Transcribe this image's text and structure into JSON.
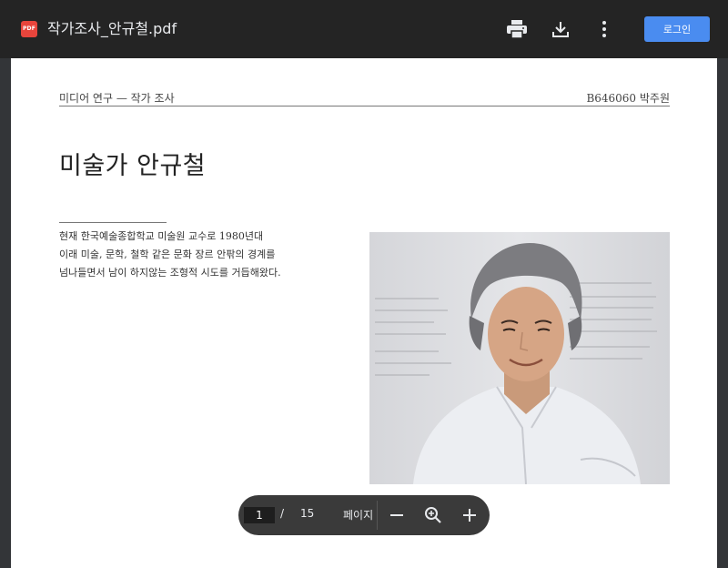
{
  "toolbar": {
    "pdf_badge": "PDF",
    "file_name": "작가조사_안규철.pdf",
    "print_icon": "print-icon",
    "download_icon": "download-icon",
    "more_icon": "more-vert-icon",
    "login_label": "로그인"
  },
  "document": {
    "header_left": "미디어 연구 — 작가 조사",
    "header_right": "B646060 박주원",
    "title": "미술가 안규철",
    "intro_lines": [
      "현재 한국예술종합학교 미술원 교수로 1980년대",
      "이래 미술, 문학, 철학 같은 문화 장르 안팎의 경계를",
      "넘나들면서 남이 하지않는 조형적 시도를 거듭해왔다."
    ]
  },
  "pager": {
    "current_page": "1",
    "separator": "/",
    "total_pages": "15",
    "page_label": "페이지",
    "zoom_out_icon": "minus-icon",
    "zoom_fit_icon": "zoom-icon",
    "zoom_in_icon": "plus-icon"
  },
  "colors": {
    "toolbar_bg": "#242424",
    "viewer_bg": "#333538",
    "login_blue": "#4a8cf0",
    "pdf_red": "#e8453c"
  }
}
